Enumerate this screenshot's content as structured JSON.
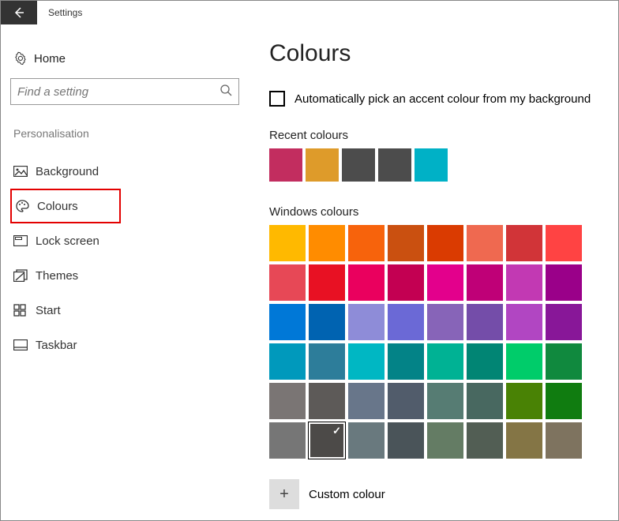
{
  "header": {
    "app_title": "Settings"
  },
  "sidebar": {
    "home_label": "Home",
    "search_placeholder": "Find a setting",
    "section_label": "Personalisation",
    "items": [
      {
        "label": "Background",
        "icon": "picture-icon"
      },
      {
        "label": "Colours",
        "icon": "palette-icon"
      },
      {
        "label": "Lock screen",
        "icon": "lockscreen-icon"
      },
      {
        "label": "Themes",
        "icon": "themes-icon"
      },
      {
        "label": "Start",
        "icon": "start-icon"
      },
      {
        "label": "Taskbar",
        "icon": "taskbar-icon"
      }
    ],
    "selected_index": 1
  },
  "main": {
    "title": "Colours",
    "auto_pick_label": "Automatically pick an accent colour from my background",
    "auto_pick_checked": false,
    "recent_heading": "Recent colours",
    "recent_colours": [
      "#c22d5f",
      "#de9b2a",
      "#4c4c4c",
      "#4c4c4c",
      "#00b1c6"
    ],
    "windows_heading": "Windows colours",
    "windows_colours": [
      "#ffb900",
      "#ff8c00",
      "#f7630c",
      "#ca5010",
      "#da3b01",
      "#ef6950",
      "#d13438",
      "#ff4343",
      "#e74856",
      "#e81123",
      "#ea005e",
      "#c30052",
      "#e3008c",
      "#bf0077",
      "#c239b3",
      "#9a0089",
      "#0078d7",
      "#0063b1",
      "#8e8cd8",
      "#6b69d6",
      "#8764b8",
      "#744da9",
      "#b146c2",
      "#881798",
      "#0099bc",
      "#2d7d9a",
      "#00b7c3",
      "#038387",
      "#00b294",
      "#018574",
      "#00cc6a",
      "#10893e",
      "#7a7574",
      "#5d5a58",
      "#68768a",
      "#515c6b",
      "#567c73",
      "#486860",
      "#498205",
      "#107c10",
      "#767676",
      "#4c4a48",
      "#69797e",
      "#4a5459",
      "#647c64",
      "#525e54",
      "#847545",
      "#7e735f"
    ],
    "selected_colour_index": 41,
    "custom_label": "Custom colour"
  }
}
